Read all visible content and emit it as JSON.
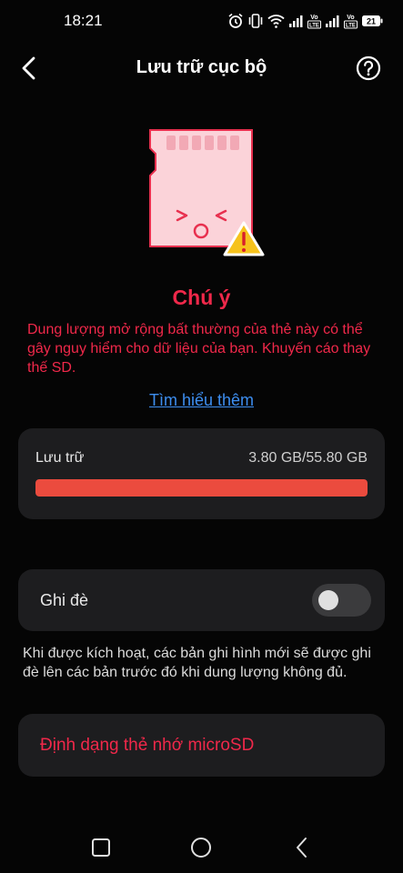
{
  "status_bar": {
    "time": "18:21",
    "icons": [
      "alarm-icon",
      "vibrate-icon",
      "wifi-icon",
      "signal-icon",
      "volte-icon",
      "signal-icon",
      "volte-icon",
      "battery-icon"
    ],
    "volte_label": "Vo LTE",
    "battery_level": "21"
  },
  "header": {
    "title": "Lưu trữ cục bộ",
    "back_icon": "chevron-left-icon",
    "help_icon": "help-circle-icon"
  },
  "warning": {
    "icon": "sd-card-warning-icon",
    "title": "Chú ý",
    "message": "Dung lượng mở rộng bất thường của thẻ này có thể gây nguy hiểm cho dữ liệu của bạn. Khuyến cáo thay thế SD.",
    "learn_more": "Tìm hiểu thêm"
  },
  "storage": {
    "label": "Lưu trữ",
    "value": "3.80 GB/55.80 GB",
    "bar_fill_fraction": 1.0
  },
  "overwrite": {
    "label": "Ghi đè",
    "enabled": false,
    "description": "Khi được kích hoạt, các bản ghi hình mới sẽ được ghi đè lên các bản trước đó khi dung lượng không đủ."
  },
  "format": {
    "label": "Định dạng thẻ nhớ microSD"
  },
  "nav_bar": {
    "buttons": [
      "recents-square-icon",
      "home-circle-icon",
      "back-triangle-icon"
    ]
  },
  "colors": {
    "background": "#050505",
    "card": "#1d1d1f",
    "warning_red": "#f0284a",
    "link_blue": "#3d8ef0",
    "progress_fill": "#eb4b3e"
  }
}
